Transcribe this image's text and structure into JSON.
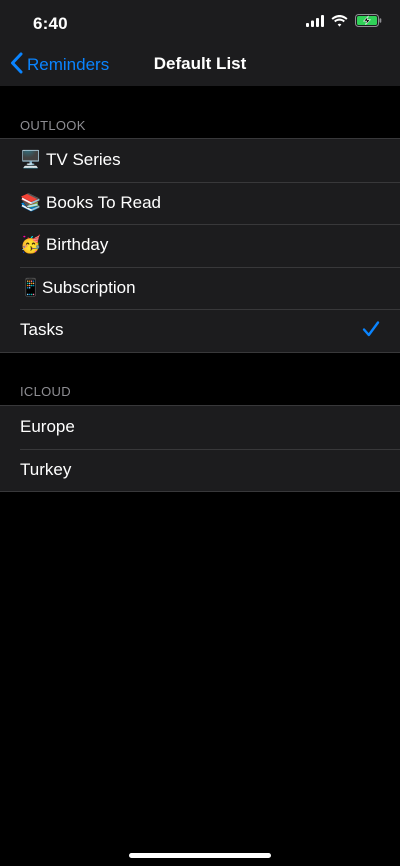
{
  "status_bar": {
    "time": "6:40",
    "icons": [
      "cellular-signal-icon",
      "wifi-icon",
      "battery-charging-icon"
    ],
    "battery_color": "#30d158"
  },
  "nav": {
    "back_label": "Reminders",
    "title": "Default List",
    "accent_color": "#0a84ff"
  },
  "sections": [
    {
      "header": "OUTLOOK",
      "items": [
        {
          "emoji": "🖥️",
          "label": "TV Series",
          "selected": false
        },
        {
          "emoji": "📚",
          "label": "Books To Read",
          "selected": false
        },
        {
          "emoji": "🥳",
          "label": "Birthday",
          "selected": false
        },
        {
          "emoji": "📱",
          "label": "Subscription",
          "selected": false
        },
        {
          "emoji": "",
          "label": "Tasks",
          "selected": true
        }
      ]
    },
    {
      "header": "ICLOUD",
      "items": [
        {
          "emoji": "",
          "label": "Europe",
          "selected": false
        },
        {
          "emoji": "",
          "label": "Turkey",
          "selected": false
        }
      ]
    }
  ]
}
